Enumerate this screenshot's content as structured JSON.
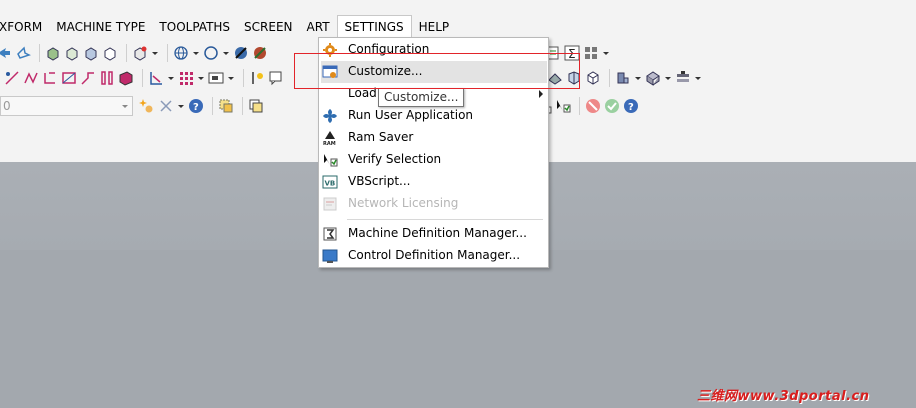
{
  "menubar": {
    "items": [
      "XFORM",
      "MACHINE TYPE",
      "TOOLPATHS",
      "SCREEN",
      "ART",
      "SETTINGS",
      "HELP"
    ],
    "active_index": 5
  },
  "toolbar": {
    "combo_value": "0"
  },
  "settings_menu": {
    "items": [
      {
        "label": "Configuration",
        "icon": "gear-icon"
      },
      {
        "label": "Customize...",
        "icon": "customize-icon"
      },
      {
        "label": "Load",
        "icon": "load-icon"
      },
      {
        "label": "Run User Application",
        "icon": "fan-icon"
      },
      {
        "label": "Ram Saver",
        "icon": "ram-saver-icon"
      },
      {
        "label": "Verify Selection",
        "icon": "verify-selection-icon"
      },
      {
        "label": "VBScript...",
        "icon": "vb-icon"
      },
      {
        "label": "Network Licensing",
        "icon": "network-license-icon"
      },
      {
        "label": "Machine Definition Manager...",
        "icon": "machine-def-icon"
      },
      {
        "label": "Control Definition Manager...",
        "icon": "control-def-icon"
      }
    ]
  },
  "tooltip": {
    "text": "Customize..."
  },
  "watermark": {
    "text": "三维网www.3dportal.cn"
  },
  "colors": {
    "highlight": "#e2242a",
    "menu_hover": "#e3e3e3",
    "chrome": "#f3f3f3",
    "viewport": "#a6abb1"
  }
}
